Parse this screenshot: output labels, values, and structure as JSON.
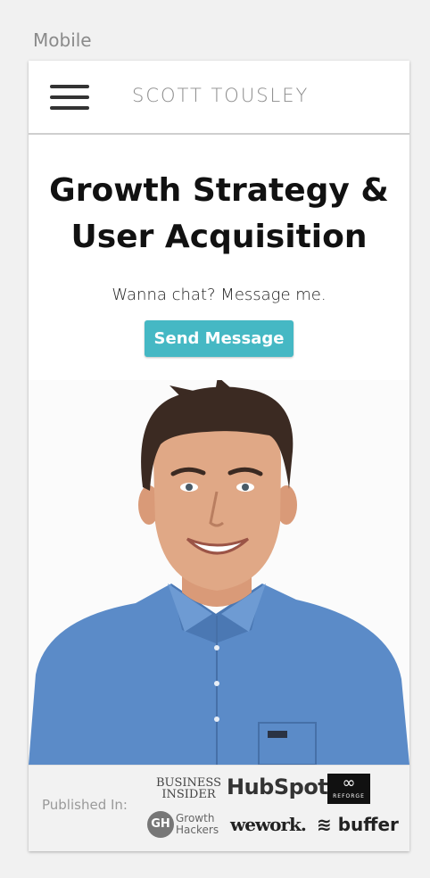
{
  "frame": {
    "label": "Mobile"
  },
  "nav": {
    "brand": "SCOTT TOUSLEY",
    "menu_icon": "hamburger-icon"
  },
  "hero": {
    "title_line1": "Growth Strategy &",
    "title_line2": "User Acquisition",
    "tagline": "Wanna chat? Message me.",
    "cta_label": "Send Message"
  },
  "colors": {
    "accent": "#45b8c4",
    "shirt": "#5b8bc8",
    "hair": "#3b2a22",
    "skin": "#e0a886"
  },
  "published": {
    "label": "Published In:",
    "logos": {
      "business_insider_line1": "BUSINESS",
      "business_insider_line2": "INSIDER",
      "hubspot": "HubSpot",
      "reforge": "REFORGE",
      "growth_hackers_mark": "GH",
      "growth_hackers_line1": "Growth",
      "growth_hackers_line2": "Hackers",
      "wework": "wework.",
      "buffer": "buffer"
    }
  }
}
